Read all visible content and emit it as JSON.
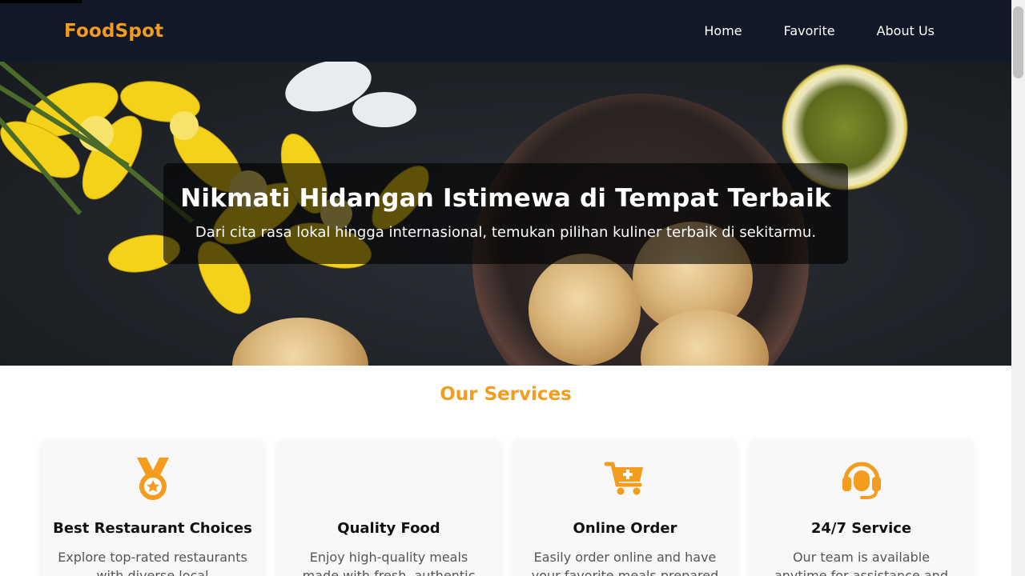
{
  "brand": "FoodSpot",
  "nav": {
    "home": "Home",
    "favorite": "Favorite",
    "about": "About Us"
  },
  "hero": {
    "title": "Nikmati Hidangan Istimewa di Tempat Terbaik",
    "subtitle": "Dari cita rasa lokal hingga internasional, temukan pilihan kuliner terbaik di sekitarmu."
  },
  "services": {
    "title": "Our Services",
    "cards": [
      {
        "title": "Best Restaurant Choices",
        "desc": "Explore top-rated restaurants with diverse local",
        "icon": "medal-icon"
      },
      {
        "title": "Quality Food",
        "desc": "Enjoy high-quality meals made with fresh, authentic",
        "icon": ""
      },
      {
        "title": "Online Order",
        "desc": "Easily order online and have your favorite meals prepared",
        "icon": "cart-plus-icon"
      },
      {
        "title": "24/7 Service",
        "desc": "Our team is available anytime for assistance and",
        "icon": "headset-icon"
      }
    ]
  },
  "colors": {
    "accent": "#f39c1d",
    "navbar": "#111827"
  }
}
